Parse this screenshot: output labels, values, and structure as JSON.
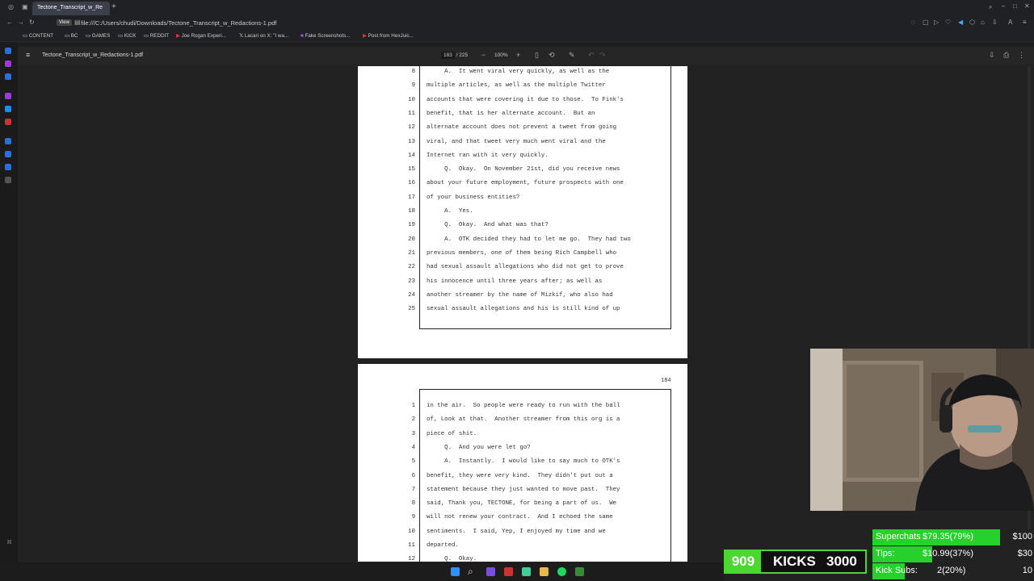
{
  "browser": {
    "tab_title": "Tectone_Transcript_w_Re",
    "url": "file:///C:/Users/chudi/Downloads/Tectone_Transcript_w_Redactions-1.pdf",
    "view_badge": "View",
    "bookmarks": [
      "CONTENT",
      "BC",
      "GAMES",
      "KICK",
      "REDDIT",
      "Joe Rogan Experi...",
      "Lacari on X: \"I wa...",
      "Fake Screenshots...",
      "Post from HexJuic..."
    ]
  },
  "pdf": {
    "filename": "Tectone_Transcript_w_Redactions-1.pdf",
    "current_page": "183",
    "total_pages": "/ 225",
    "zoom": "100%",
    "page183_lines": [
      {
        "n": "8",
        "t": "     A.  It went viral very quickly, as well as the"
      },
      {
        "n": "9",
        "t": "multiple articles, as well as the multiple Twitter"
      },
      {
        "n": "10",
        "t": "accounts that were covering it due to those.  To Fink's"
      },
      {
        "n": "11",
        "t": "benefit, that is her alternate account.  But an"
      },
      {
        "n": "12",
        "t": "alternate account does not prevent a tweet from going"
      },
      {
        "n": "13",
        "t": "viral, and that tweet very much went viral and the"
      },
      {
        "n": "14",
        "t": "Internet ran with it very quickly."
      },
      {
        "n": "15",
        "t": "     Q.  Okay.  On November 21st, did you receive news"
      },
      {
        "n": "16",
        "t": "about your future employment, future prospects with one"
      },
      {
        "n": "17",
        "t": "of your business entities?"
      },
      {
        "n": "18",
        "t": "     A.  Yes."
      },
      {
        "n": "19",
        "t": "     Q.  Okay.  And what was that?"
      },
      {
        "n": "20",
        "t": "     A.  OTK decided they had to let me go.  They had two"
      },
      {
        "n": "21",
        "t": "previous members, one of them being Rich Campbell who"
      },
      {
        "n": "22",
        "t": "had sexual assault allegations who did not get to prove"
      },
      {
        "n": "23",
        "t": "his innocence until three years after; as well as"
      },
      {
        "n": "24",
        "t": "another streamer by the name of Mizkif, who also had"
      },
      {
        "n": "25",
        "t": "sexual assault allegations and his is still kind of up"
      }
    ],
    "page184_number": "184",
    "page184_lines": [
      {
        "n": "1",
        "t": "in the air.  So people were ready to run with the ball"
      },
      {
        "n": "2",
        "t": "of, Look at that.  Another streamer from this org is a"
      },
      {
        "n": "3",
        "t": "piece of shit."
      },
      {
        "n": "4",
        "t": "     Q.  And you were let go?"
      },
      {
        "n": "5",
        "t": "     A.  Instantly.  I would like to say much to OTK's"
      },
      {
        "n": "6",
        "t": "benefit, they were very kind.  They didn't put out a"
      },
      {
        "n": "7",
        "t": "statement because they just wanted to move past.  They"
      },
      {
        "n": "8",
        "t": "said, Thank you, TECTONE, for being a part of us.  We"
      },
      {
        "n": "9",
        "t": "will not renew your contract.  And I echoed the same"
      },
      {
        "n": "10",
        "t": "sentiments.  I said, Yep, I enjoyed my time and we"
      },
      {
        "n": "11",
        "t": "departed."
      },
      {
        "n": "12",
        "t": "     Q.  Okay."
      }
    ]
  },
  "overlay": {
    "superchats_label": "Superchats",
    "superchats_value": "$79.35(79%)",
    "superchats_percent": 79,
    "superchats_goal": "$100",
    "tips_label": "Tips:",
    "tips_value": "$10.99(37%)",
    "tips_percent": 37,
    "tips_goal": "$30",
    "kicksubs_label": "Kick Subs:",
    "kicksubs_value": "2(20%)",
    "kicksubs_percent": 20,
    "kicksubs_goal": "10",
    "kicks_count": "909",
    "kicks_label": "KICKS",
    "kicks_goal": "3000"
  },
  "colors": {
    "accent_green": "#4cd631",
    "tab_active": "#3a3f4a"
  }
}
